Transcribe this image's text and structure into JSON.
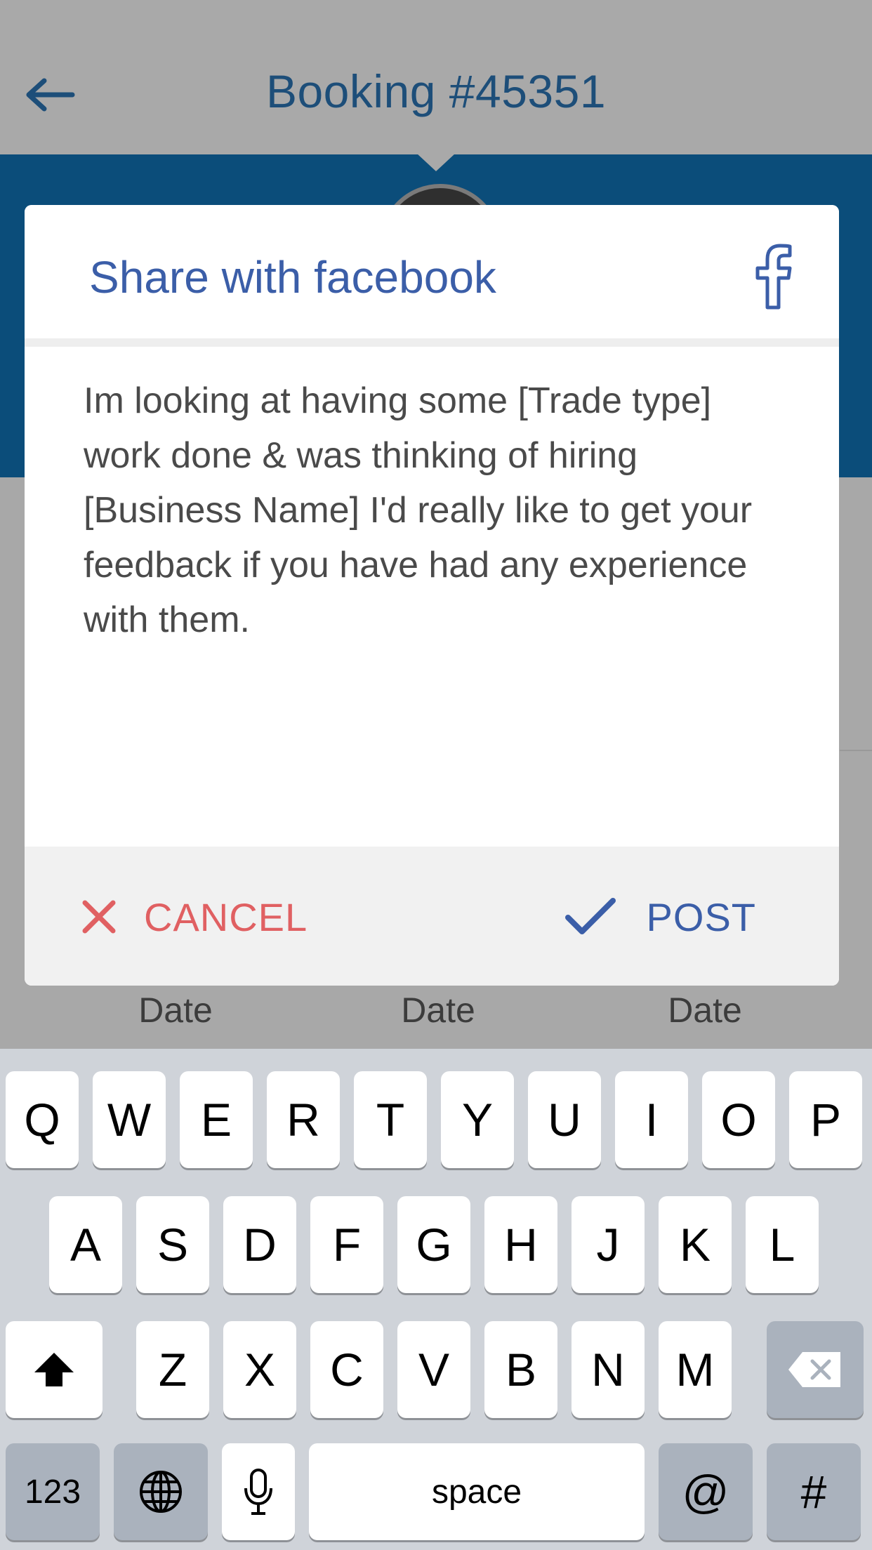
{
  "header": {
    "title": "Booking #45351",
    "back_icon": "arrow-left-icon"
  },
  "background": {
    "date_labels": [
      "Date",
      "Date",
      "Date"
    ]
  },
  "modal": {
    "title": "Share with facebook",
    "brand_icon": "facebook-icon",
    "message": "Im looking at having some [Trade type] work done & was thinking of hiring [Business Name] I'd really like to get your feedback if you have had any experience with them.",
    "cancel_label": "CANCEL",
    "post_label": "POST",
    "colors": {
      "title": "#3b5ea8",
      "cancel": "#e06062",
      "post": "#3b5ea8",
      "header_band": "#0b4d7a"
    }
  },
  "keyboard": {
    "row1": [
      "Q",
      "W",
      "E",
      "R",
      "T",
      "Y",
      "U",
      "I",
      "O",
      "P"
    ],
    "row2": [
      "A",
      "S",
      "D",
      "F",
      "G",
      "H",
      "J",
      "K",
      "L"
    ],
    "row3": [
      "Z",
      "X",
      "C",
      "V",
      "B",
      "N",
      "M"
    ],
    "shift_icon": "shift-icon",
    "delete_icon": "backspace-icon",
    "numbers_label": "123",
    "globe_icon": "globe-icon",
    "mic_icon": "microphone-icon",
    "space_label": "space",
    "at_label": "@",
    "hash_label": "#"
  }
}
